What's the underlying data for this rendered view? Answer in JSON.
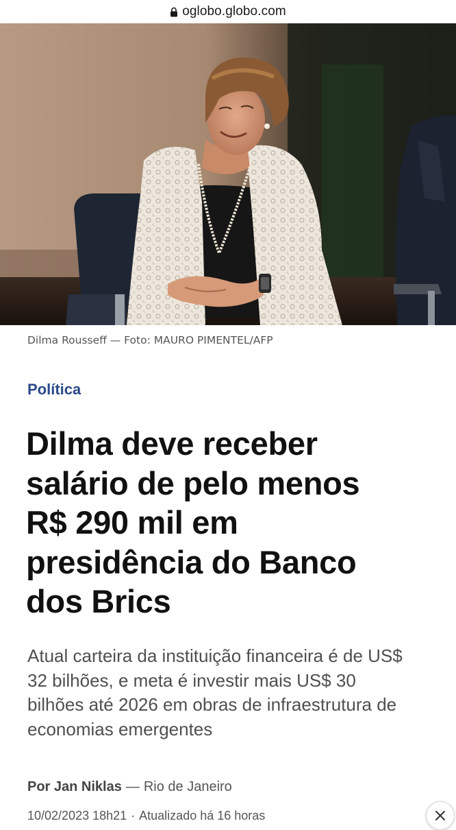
{
  "browser": {
    "url": "oglobo.globo.com",
    "lock_icon": "lock-icon"
  },
  "hero": {
    "caption": "Dilma Rousseff — Foto: MAURO PIMENTEL/AFP"
  },
  "article": {
    "section": "Política",
    "headline_lines": [
      "Dilma deve receber",
      "salário de pelo menos",
      "R$ 290 mil em",
      "presidência do Banco",
      "dos Brics"
    ],
    "subhead_lines": [
      "Atual carteira da instituição financeira é de US$",
      "32 bilhões, e meta é investir mais US$ 30",
      "bilhões até 2026 em obras de infraestrutura de",
      "economias emergentes"
    ],
    "byline": {
      "author": "Por Jan Niklas",
      "separator": "—",
      "location": "Rio de Janeiro"
    },
    "dateline": {
      "published": "10/02/2023 18h21",
      "separator": "·",
      "updated": "Atualizado há 16 horas"
    }
  },
  "overlay": {
    "close_icon": "close-icon"
  }
}
